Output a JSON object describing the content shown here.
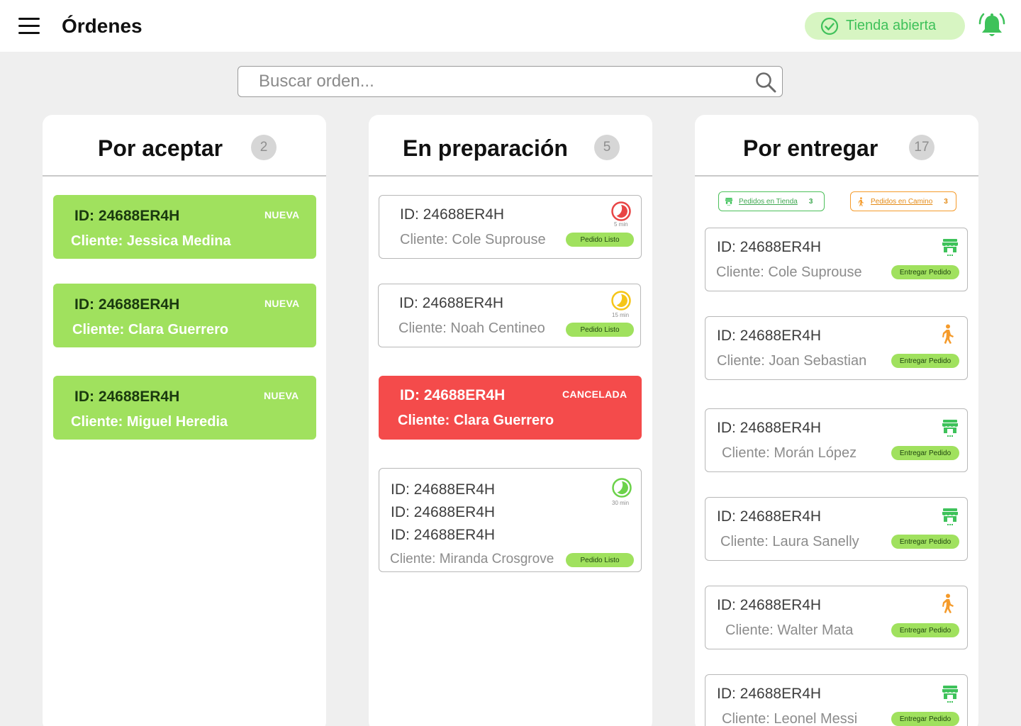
{
  "header": {
    "title": "Órdenes",
    "store_status": "Tienda abierta"
  },
  "search": {
    "placeholder": "Buscar orden..."
  },
  "colors": {
    "green_card": "#a0e15e",
    "cancel_card": "#f44b4b",
    "accent_green": "#3fc15a",
    "walk_orange": "#f59b2b",
    "timer_red": "#e84545",
    "timer_yellow": "#f5c518",
    "timer_green": "#6cd24a"
  },
  "columns": {
    "accept": {
      "title": "Por aceptar",
      "count": "2",
      "cards": [
        {
          "id": "ID: 24688ER4H",
          "client": "Cliente: Jessica Medina",
          "tag": "NUEVA"
        },
        {
          "id": "ID: 24688ER4H",
          "client": "Cliente: Clara Guerrero",
          "tag": "NUEVA"
        },
        {
          "id": "ID: 24688ER4H",
          "client": "Cliente: Miguel Heredia",
          "tag": "NUEVA"
        }
      ]
    },
    "prep": {
      "title": "En preparación",
      "count": "5",
      "cards": [
        {
          "id": "ID: 24688ER4H",
          "client": "Cliente: Cole Suprouse",
          "timer": "5 min",
          "timer_color": "red",
          "button": "Pedido Listo"
        },
        {
          "id": "ID: 24688ER4H",
          "client": "Cliente: Noah Centineo",
          "timer": "15 min",
          "timer_color": "yellow",
          "button": "Pedido Listo"
        },
        {
          "id": "ID: 24688ER4H",
          "client": "Cliente: Clara Guerrero",
          "tag": "CANCELADA"
        },
        {
          "ids": [
            "ID: 24688ER4H",
            "ID: 24688ER4H",
            "ID: 24688ER4H"
          ],
          "client": "Cliente: Miranda Crosgrove",
          "timer": "30 min",
          "timer_color": "green",
          "button": "Pedido Listo"
        }
      ]
    },
    "deliver": {
      "title": "Por entregar",
      "count": "17",
      "filters": [
        {
          "label": "Pedidos en Tienda",
          "count": "3",
          "icon": "store-icon"
        },
        {
          "label": "Pedidos en Camino",
          "count": "3",
          "icon": "walking-icon"
        }
      ],
      "cards": [
        {
          "id": "ID: 24688ER4H",
          "client": "Cliente: Cole Suprouse",
          "icon": "store-icon",
          "button": "Entregar Pedido"
        },
        {
          "id": "ID: 24688ER4H",
          "client": "Cliente: Joan Sebastian",
          "icon": "walking-icon",
          "button": "Entregar Pedido"
        },
        {
          "id": "ID: 24688ER4H",
          "client": "Cliente: Morán López",
          "icon": "store-icon",
          "button": "Entregar Pedido"
        },
        {
          "id": "ID: 24688ER4H",
          "client": "Cliente: Laura Sanelly",
          "icon": "store-icon",
          "button": "Entregar Pedido"
        },
        {
          "id": "ID: 24688ER4H",
          "client": "Cliente: Walter Mata",
          "icon": "walking-icon",
          "button": "Entregar Pedido"
        },
        {
          "id": "ID: 24688ER4H",
          "client": "Cliente: Leonel Messi",
          "icon": "store-icon",
          "button": "Entregar Pedido"
        }
      ]
    }
  }
}
